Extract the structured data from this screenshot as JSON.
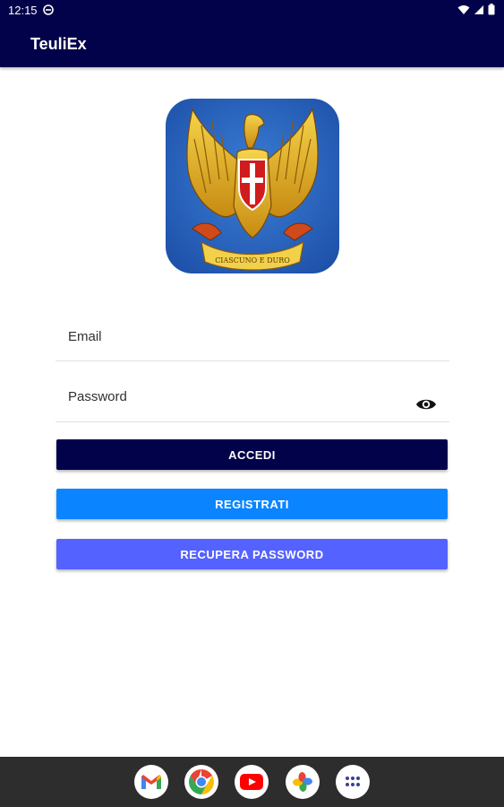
{
  "status_bar": {
    "time": "12:15",
    "icons": [
      "do-not-disturb-icon",
      "wifi-icon",
      "signal-icon",
      "battery-icon"
    ]
  },
  "app_bar": {
    "title": "TeuliEx"
  },
  "logo": {
    "description_icon": "eagle-emblem-icon",
    "motto": "CIASCUNO E DURO"
  },
  "form": {
    "email_label": "Email",
    "password_label": "Password"
  },
  "buttons": {
    "accedi": "ACCEDI",
    "registrati": "REGISTRATI",
    "recupera": "RECUPERA PASSWORD"
  },
  "colors": {
    "primary": "#02024a",
    "registrati": "#0a85ff",
    "recupera": "#5462ff"
  },
  "dock": {
    "apps": [
      "gmail-icon",
      "chrome-icon",
      "youtube-icon",
      "photos-icon",
      "app-drawer-icon"
    ]
  }
}
